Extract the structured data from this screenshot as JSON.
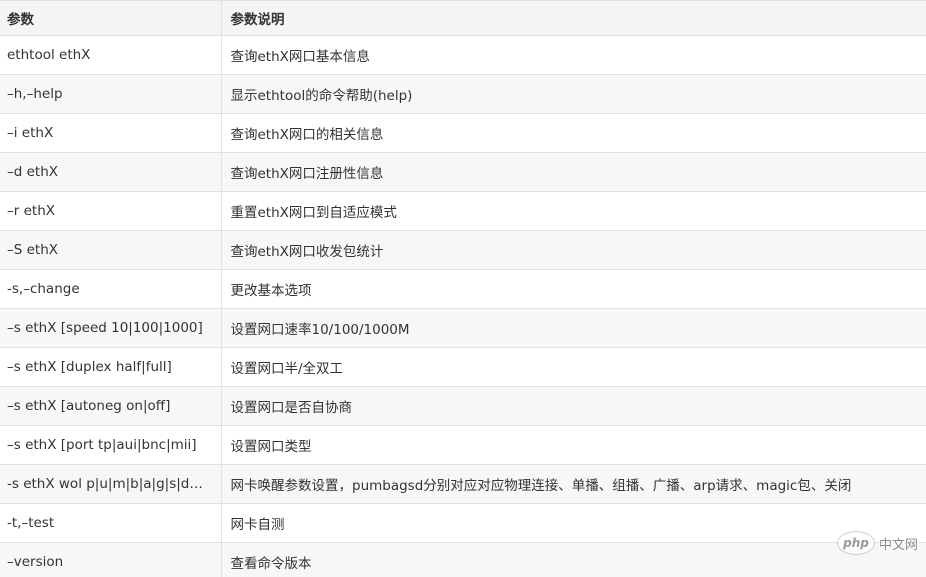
{
  "table": {
    "headers": [
      "参数",
      "参数说明"
    ],
    "rows": [
      [
        "ethtool ethX",
        "查询ethX网口基本信息"
      ],
      [
        "–h,–help",
        "显示ethtool的命令帮助(help)"
      ],
      [
        "–i ethX",
        "查询ethX网口的相关信息"
      ],
      [
        "–d ethX",
        "查询ethX网口注册性信息"
      ],
      [
        "–r ethX",
        "重置ethX网口到自适应模式"
      ],
      [
        "–S ethX",
        "查询ethX网口收发包统计"
      ],
      [
        "-s,–change",
        "更改基本选项"
      ],
      [
        "–s ethX [speed 10|100|1000]",
        "设置网口速率10/100/1000M"
      ],
      [
        "–s ethX [duplex half|full]",
        "设置网口半/全双工"
      ],
      [
        "–s ethX [autoneg on|off]",
        "设置网口是否自协商"
      ],
      [
        "–s ethX [port tp|aui|bnc|mii]",
        "设置网口类型"
      ],
      [
        "-s ethX wol p|u|m|b|a|g|s|d…",
        "网卡唤醒参数设置，pumbagsd分别对应对应物理连接、单播、组播、广播、arp请求、magic包、关闭"
      ],
      [
        "-t,–test",
        "网卡自测"
      ],
      [
        "–version",
        "查看命令版本"
      ]
    ]
  },
  "watermark": {
    "logo_text": "php",
    "text": "中文网"
  }
}
